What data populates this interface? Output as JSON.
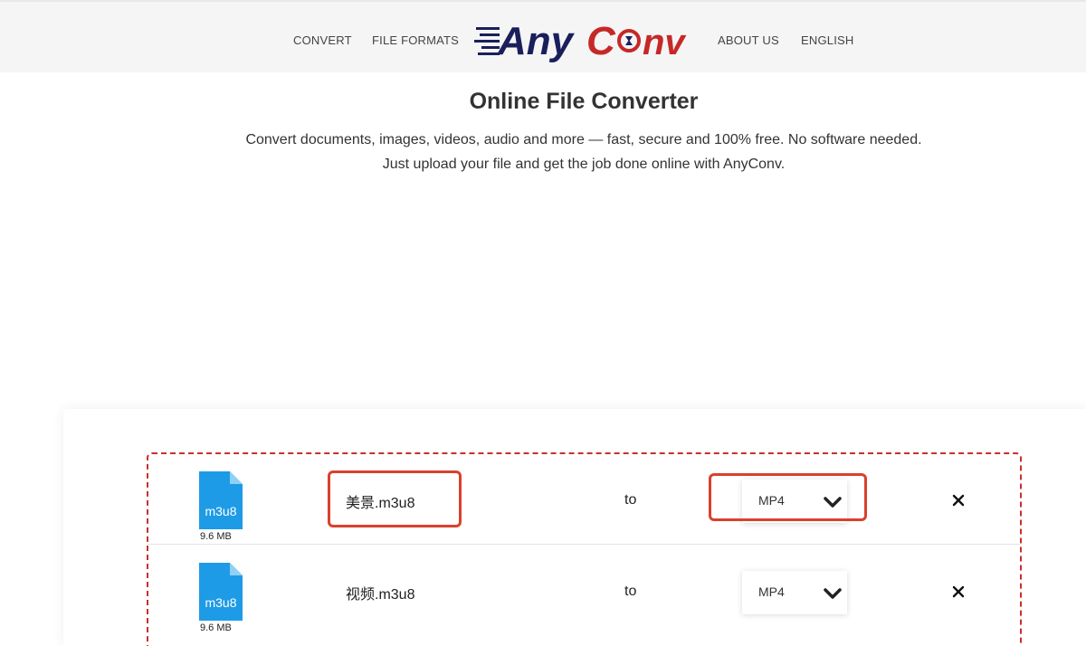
{
  "nav": {
    "convert": "CONVERT",
    "file_formats": "FILE FORMATS",
    "about_us": "ABOUT US",
    "language": "ENGLISH"
  },
  "logo": {
    "text_any": "Any",
    "text_c": "C",
    "text_nv": "nv",
    "color_any": "#1a1f5c",
    "color_conv": "#c62828"
  },
  "hero": {
    "title": "Online File Converter",
    "description": "Convert documents, images, videos, audio and more — fast, secure and 100% free. No software needed. Just upload your file and get the job done online with AnyConv."
  },
  "files": [
    {
      "ext": "m3u8",
      "size": "9.6 MB",
      "name": "美景.m3u8",
      "to": "to",
      "format": "MP4"
    },
    {
      "ext": "m3u8",
      "size": "9.6 MB",
      "name": "视频.m3u8",
      "to": "to",
      "format": "MP4"
    }
  ],
  "colors": {
    "file_icon": "#1e9be6",
    "dashed_border": "#c9302c",
    "highlight": "#d9412b"
  },
  "icons": {
    "remove": "close-icon",
    "dropdown": "chevron-down-icon",
    "file": "file-icon"
  }
}
